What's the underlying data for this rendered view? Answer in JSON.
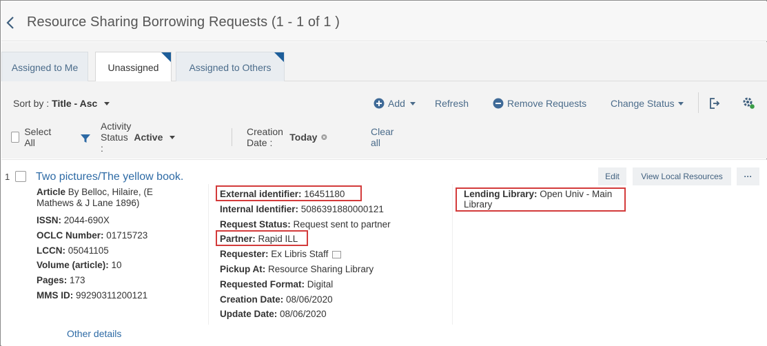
{
  "header": {
    "title": "Resource Sharing Borrowing Requests (1 - 1 of 1 )"
  },
  "tabs": [
    {
      "label": "Assigned to Me"
    },
    {
      "label": "Unassigned"
    },
    {
      "label": "Assigned to Others"
    }
  ],
  "toolbar": {
    "sort_prefix": "Sort by :",
    "sort_value": "Title - Asc",
    "add_label": "Add",
    "refresh_label": "Refresh",
    "remove_label": "Remove Requests",
    "change_status_label": "Change Status"
  },
  "filters": {
    "select_all": "Select All",
    "activity_status_label": "Activity Status :",
    "activity_status_value": "Active",
    "creation_date_label": "Creation Date :",
    "creation_date_value": "Today",
    "clear_all": "Clear all"
  },
  "record": {
    "number": "1",
    "title": "Two pictures/The yellow book.",
    "edit_label": "Edit",
    "view_local_label": "View Local Resources",
    "more_label": "···",
    "left": {
      "article_label": "Article",
      "article_value": " By Belloc, Hilaire, (E",
      "article_value2": "Mathews & J Lane 1896)",
      "issn_label": "ISSN:",
      "issn_value": " 2044-690X",
      "oclc_label": "OCLC Number:",
      "oclc_value": " 01715723",
      "lccn_label": "LCCN:",
      "lccn_value": " 05041105",
      "volume_label": "Volume (article):",
      "volume_value": " 10",
      "pages_label": "Pages:",
      "pages_value": " 173",
      "mms_label": "MMS ID:",
      "mms_value": " 99290311200121"
    },
    "middle": {
      "ext_id_label": "External identifier:",
      "ext_id_value": " 16451180",
      "int_id_label": "Internal Identifier:",
      "int_id_value": " 5086391880000121",
      "status_label": "Request Status:",
      "status_value": " Request sent to partner",
      "partner_label": "Partner:",
      "partner_value": " Rapid ILL",
      "requester_label": "Requester:",
      "requester_value": " Ex Libris Staff",
      "pickup_label": "Pickup At:",
      "pickup_value": " Resource Sharing Library",
      "format_label": "Requested Format:",
      "format_value": " Digital",
      "creation_label": "Creation Date:",
      "creation_value": " 08/06/2020",
      "update_label": "Update Date:",
      "update_value": " 08/06/2020"
    },
    "right": {
      "lending_label": "Lending Library:",
      "lending_value": " Open Univ - Main",
      "lending_value2": "Library"
    },
    "other_details": "Other details"
  },
  "colors": {
    "accent": "#2d6aa5",
    "tab_corner": "#1d5e9a",
    "highlight": "#d33a3a"
  }
}
